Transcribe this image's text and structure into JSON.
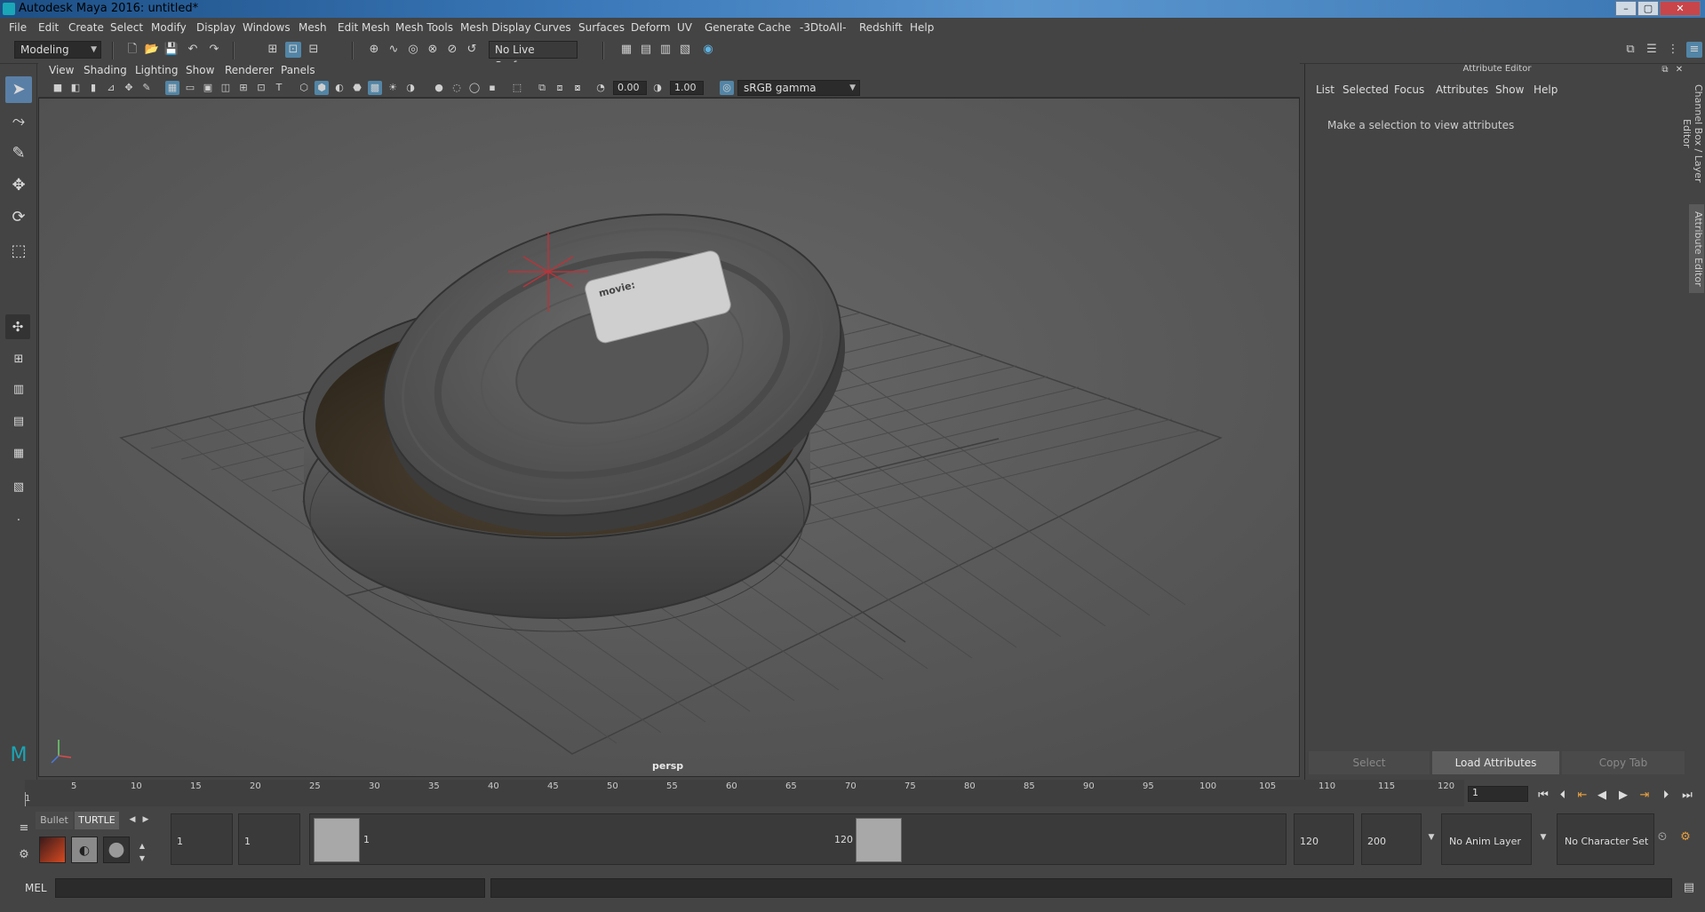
{
  "window": {
    "title": "Autodesk Maya 2016: untitled*",
    "min": "–",
    "max": "▢",
    "close": "✕"
  },
  "menubar": [
    "File",
    "Edit",
    "Create",
    "Select",
    "Modify",
    "Display",
    "Windows",
    "Mesh",
    "Edit Mesh",
    "Mesh Tools",
    "Mesh Display",
    "Curves",
    "Surfaces",
    "Deform",
    "UV",
    "Generate",
    "Cache",
    "-3DtoAll-",
    "Redshift",
    "Help"
  ],
  "shelf": {
    "mode": "Modeling",
    "live_surface": "No Live Surface"
  },
  "viewport": {
    "menus": [
      "View",
      "Shading",
      "Lighting",
      "Show",
      "Renderer",
      "Panels"
    ],
    "exposure": "0.00",
    "gamma": "1.00",
    "colorspace": "sRGB gamma",
    "camera": "persp",
    "lid_label": "movie:"
  },
  "attribute_editor": {
    "title": "Attribute Editor",
    "menus": [
      "List",
      "Selected",
      "Focus",
      "Attributes",
      "Show",
      "Help"
    ],
    "message": "Make a selection to view attributes",
    "buttons": {
      "select": "Select",
      "load": "Load Attributes",
      "copy": "Copy Tab"
    }
  },
  "side_tabs": {
    "channel_box": "Channel Box / Layer Editor",
    "attribute_editor": "Attribute Editor"
  },
  "timeline": {
    "ticks": [
      "5",
      "10",
      "15",
      "20",
      "25",
      "30",
      "35",
      "40",
      "45",
      "50",
      "55",
      "60",
      "65",
      "70",
      "75",
      "80",
      "85",
      "90",
      "95",
      "100",
      "105",
      "110",
      "115",
      "120"
    ],
    "start_label": "1",
    "current_frame": "1"
  },
  "range": {
    "shelf_tabs": [
      "Bullet",
      "TURTLE"
    ],
    "start": "1",
    "playback_start": "1",
    "slider_min": "1",
    "slider_max": "120",
    "playback_end": "120",
    "end": "200",
    "anim_layer": "No Anim Layer",
    "char_set": "No Character Set"
  },
  "command": {
    "label": "MEL"
  }
}
